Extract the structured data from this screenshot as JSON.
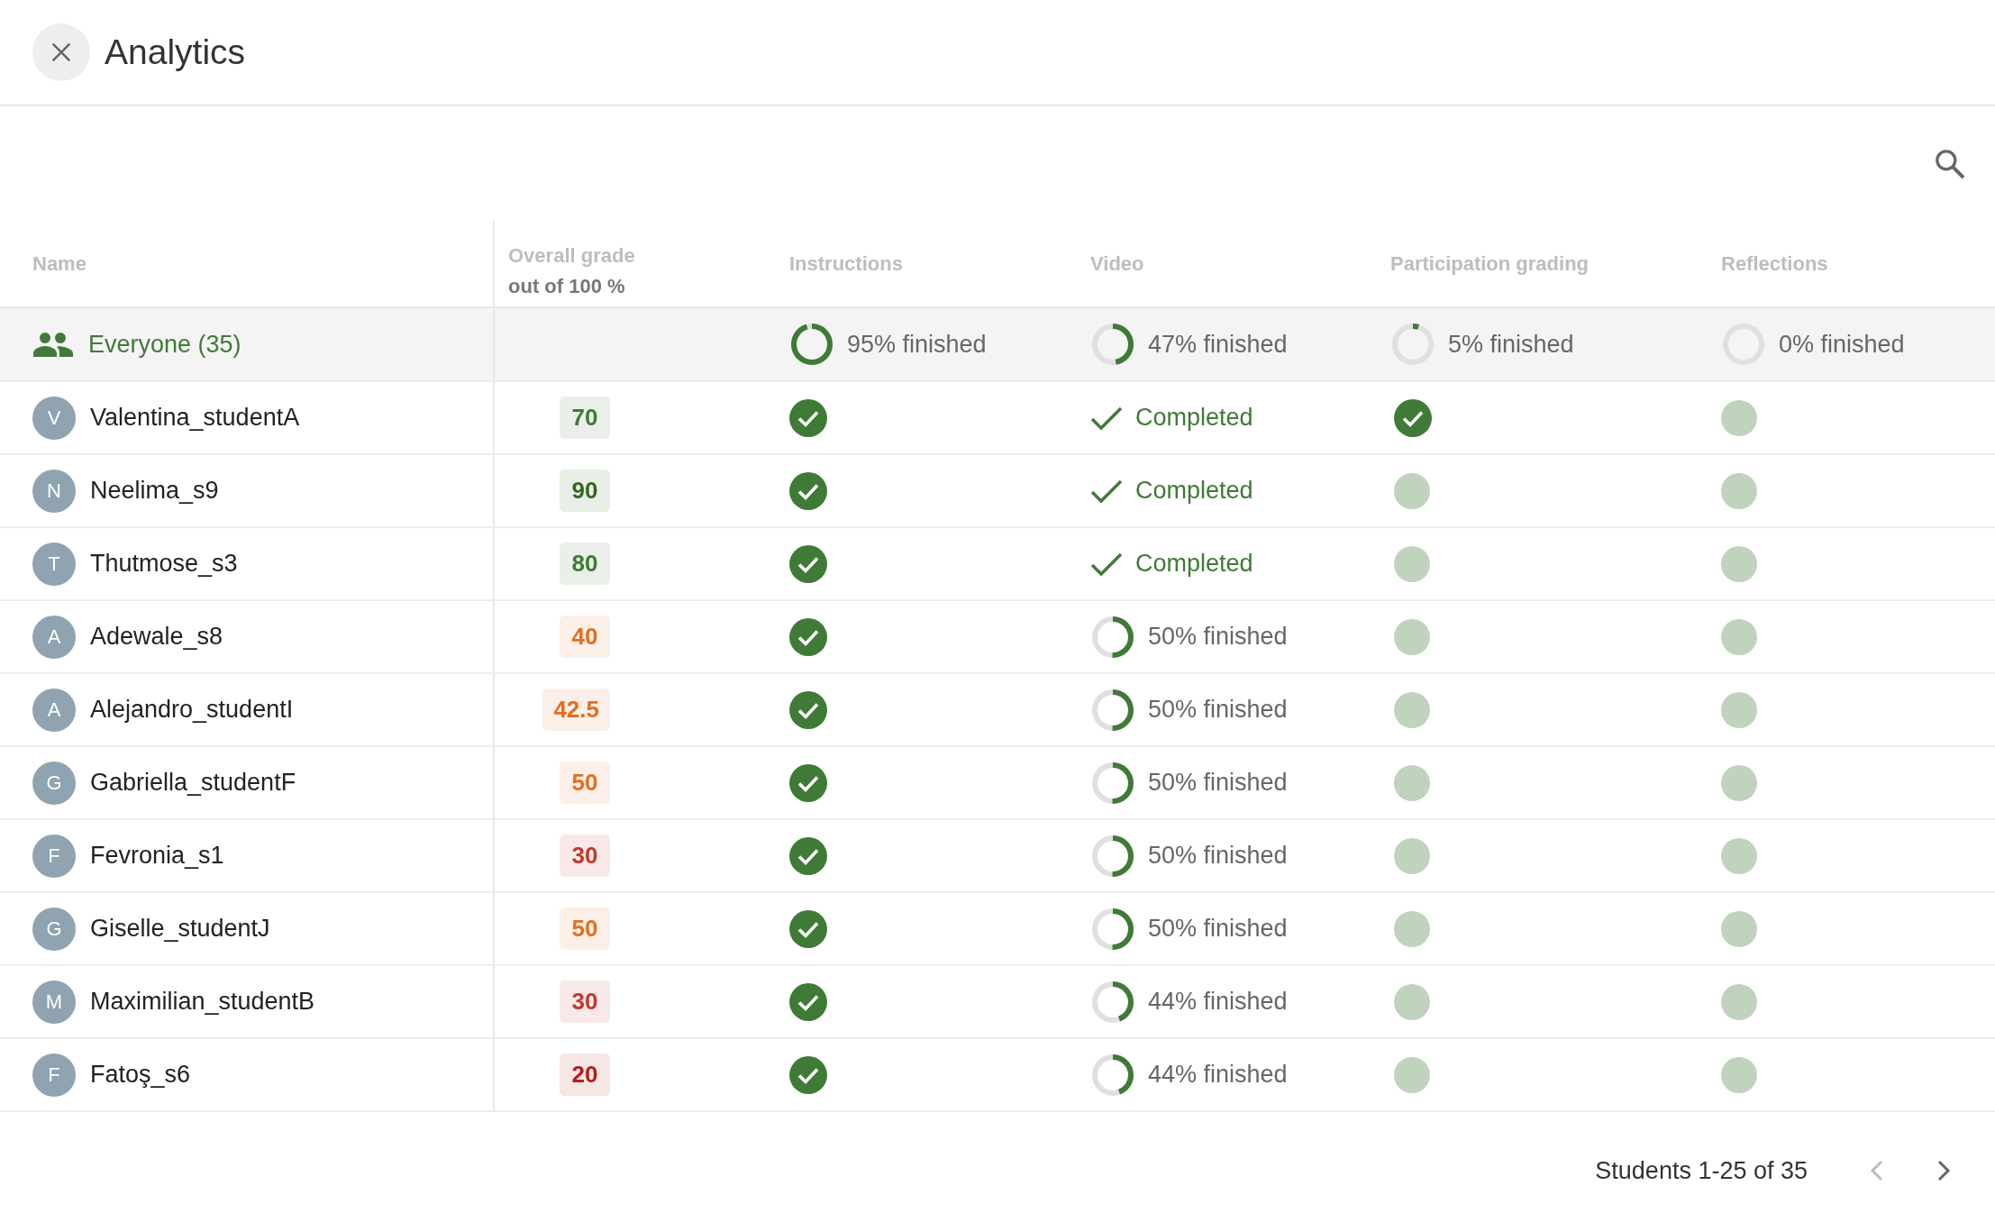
{
  "header": {
    "title": "Analytics"
  },
  "table": {
    "columns": [
      {
        "label": "Name"
      },
      {
        "label": "Overall grade",
        "sublabel": "out of 100 %"
      },
      {
        "label": "Instructions"
      },
      {
        "label": "Video"
      },
      {
        "label": "Participation grading"
      },
      {
        "label": "Reflections"
      }
    ],
    "summary": {
      "label": "Everyone (35)",
      "cells": [
        {
          "kind": "progress",
          "level": 0.95,
          "text": "95% finished"
        },
        {
          "kind": "progress",
          "level": 0.47,
          "text": "47% finished"
        },
        {
          "kind": "progress",
          "level": 0.05,
          "text": "5% finished"
        },
        {
          "kind": "progress",
          "level": 0,
          "text": "0% finished"
        }
      ]
    },
    "rows": [
      {
        "initial": "V",
        "name": "Valentina_studentA",
        "grade": {
          "value": "70",
          "color": "#3f7a36"
        },
        "cells": [
          {
            "kind": "done"
          },
          {
            "kind": "completed",
            "text": "Completed"
          },
          {
            "kind": "done"
          },
          {
            "kind": "pending"
          }
        ]
      },
      {
        "initial": "N",
        "name": "Neelima_s9",
        "grade": {
          "value": "90",
          "color": "#33691e"
        },
        "cells": [
          {
            "kind": "done"
          },
          {
            "kind": "completed",
            "text": "Completed"
          },
          {
            "kind": "pending"
          },
          {
            "kind": "pending"
          }
        ]
      },
      {
        "initial": "T",
        "name": "Thutmose_s3",
        "grade": {
          "value": "80",
          "color": "#3f7a36"
        },
        "cells": [
          {
            "kind": "done"
          },
          {
            "kind": "completed",
            "text": "Completed"
          },
          {
            "kind": "pending"
          },
          {
            "kind": "pending"
          }
        ]
      },
      {
        "initial": "A",
        "name": "Adewale_s8",
        "grade": {
          "value": "40",
          "color": "#e07020"
        },
        "cells": [
          {
            "kind": "done"
          },
          {
            "kind": "progress",
            "level": 0.5,
            "text": "50% finished"
          },
          {
            "kind": "pending"
          },
          {
            "kind": "pending"
          }
        ]
      },
      {
        "initial": "A",
        "name": "Alejandro_studentI",
        "grade": {
          "value": "42.5",
          "color": "#e07020"
        },
        "cells": [
          {
            "kind": "done"
          },
          {
            "kind": "progress",
            "level": 0.5,
            "text": "50% finished"
          },
          {
            "kind": "pending"
          },
          {
            "kind": "pending"
          }
        ]
      },
      {
        "initial": "G",
        "name": "Gabriella_studentF",
        "grade": {
          "value": "50",
          "color": "#e07020"
        },
        "cells": [
          {
            "kind": "done"
          },
          {
            "kind": "progress",
            "level": 0.5,
            "text": "50% finished"
          },
          {
            "kind": "pending"
          },
          {
            "kind": "pending"
          }
        ]
      },
      {
        "initial": "F",
        "name": "Fevronia_s1",
        "grade": {
          "value": "30",
          "color": "#c0392b"
        },
        "cells": [
          {
            "kind": "done"
          },
          {
            "kind": "progress",
            "level": 0.5,
            "text": "50% finished"
          },
          {
            "kind": "pending"
          },
          {
            "kind": "pending"
          }
        ]
      },
      {
        "initial": "G",
        "name": "Giselle_studentJ",
        "grade": {
          "value": "50",
          "color": "#e07020"
        },
        "cells": [
          {
            "kind": "done"
          },
          {
            "kind": "progress",
            "level": 0.5,
            "text": "50% finished"
          },
          {
            "kind": "pending"
          },
          {
            "kind": "pending"
          }
        ]
      },
      {
        "initial": "M",
        "name": "Maximilian_studentB",
        "grade": {
          "value": "30",
          "color": "#c0392b"
        },
        "cells": [
          {
            "kind": "done"
          },
          {
            "kind": "progress",
            "level": 0.44,
            "text": "44% finished"
          },
          {
            "kind": "pending"
          },
          {
            "kind": "pending"
          }
        ]
      },
      {
        "initial": "F",
        "name": "Fatoş_s6",
        "grade": {
          "value": "20",
          "color": "#b71c1c"
        },
        "cells": [
          {
            "kind": "done"
          },
          {
            "kind": "progress",
            "level": 0.44,
            "text": "44% finished"
          },
          {
            "kind": "pending"
          },
          {
            "kind": "pending"
          }
        ]
      }
    ]
  },
  "pagination": {
    "label": "Students 1-25 of 35",
    "previous_disabled": true,
    "next_disabled": false
  }
}
